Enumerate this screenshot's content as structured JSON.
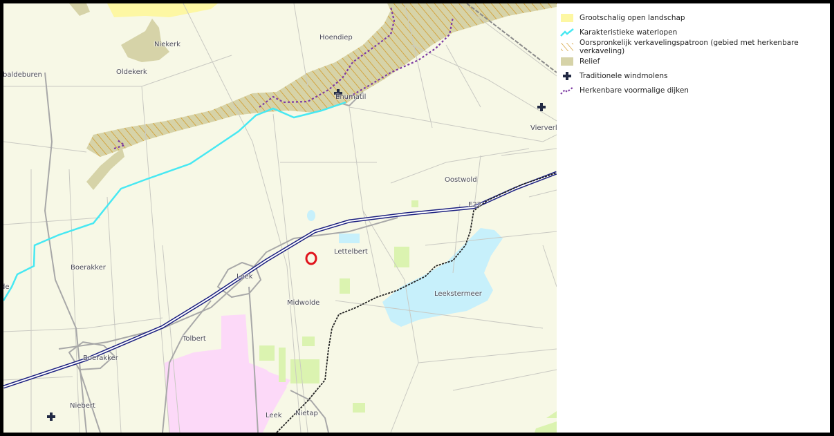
{
  "map": {
    "places": [
      {
        "id": "niekerk",
        "label": "Niekerk"
      },
      {
        "id": "hoendiep",
        "label": "Hoendiep"
      },
      {
        "id": "oldekerk",
        "label": "Oldekerk"
      },
      {
        "id": "baldeburen",
        "label": "baldeburen"
      },
      {
        "id": "enumatil",
        "label": "Enumatil"
      },
      {
        "id": "vierverlaten",
        "label": "Vierverl"
      },
      {
        "id": "oostwold",
        "label": "Oostwold"
      },
      {
        "id": "e22",
        "label": "E22"
      },
      {
        "id": "lettelbert",
        "label": "Lettelbert"
      },
      {
        "id": "boerakker-n",
        "label": "Boerakker"
      },
      {
        "id": "leek",
        "label": "Leek"
      },
      {
        "id": "midwolde",
        "label": "Midwolde"
      },
      {
        "id": "leekstermeer",
        "label": "Leekstermeer"
      },
      {
        "id": "tolbert",
        "label": "Tolbert"
      },
      {
        "id": "boerakker-s",
        "label": "Boerakker"
      },
      {
        "id": "niebert",
        "label": "Niebert"
      },
      {
        "id": "leek-s",
        "label": "Leek"
      },
      {
        "id": "nietap",
        "label": "Nietap"
      },
      {
        "id": "de",
        "label": "de"
      }
    ],
    "colors": {
      "background": "#f7f8e6",
      "open_landscape": "#fdf7a3",
      "waterway": "#47e8f2",
      "allotment_hatch": "#d29a2a",
      "relief": "#d6d3a8",
      "windmill": "#222a44",
      "dike": "#7d3aa3",
      "water": "#c7f0fb",
      "urban": "#fcd9f8",
      "forest": "#dbf3b0",
      "marker": "#e0141c",
      "border": "#333333"
    }
  },
  "legend": {
    "items": [
      {
        "label": "Grootschalig open landschap",
        "icon": "open-landscape-swatch"
      },
      {
        "label": "Karakteristieke waterlopen",
        "icon": "waterway-line-icon"
      },
      {
        "label": "Oorspronkelijk verkavelingspatroon (gebied met herkenbare verkaveling)",
        "icon": "hatch-swatch"
      },
      {
        "label": "Relief",
        "icon": "relief-swatch"
      },
      {
        "label": "Traditionele windmolens",
        "icon": "windmill-icon"
      },
      {
        "label": "Herkenbare voormalige dijken",
        "icon": "dike-line-icon"
      }
    ]
  }
}
